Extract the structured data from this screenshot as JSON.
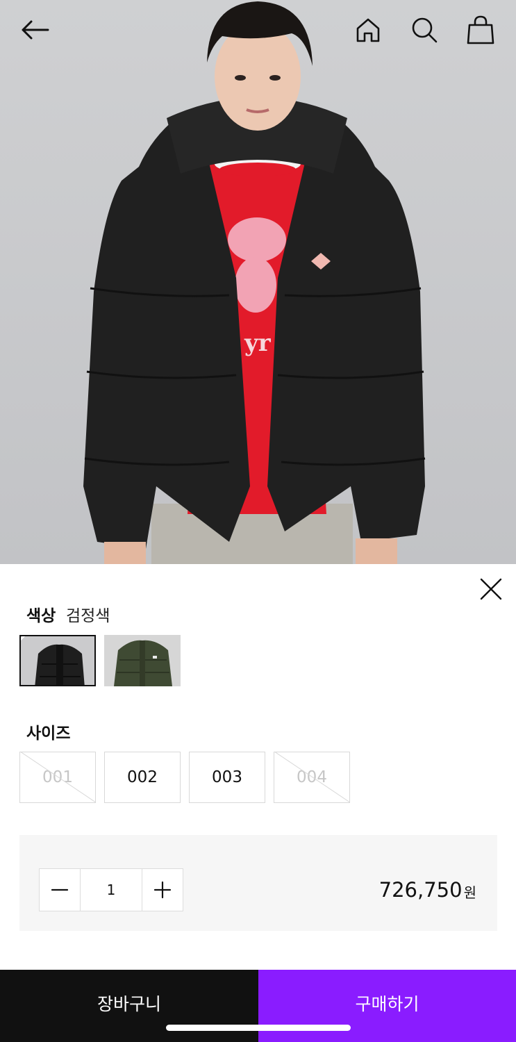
{
  "header": {
    "back_icon": "arrow-left-icon",
    "home_icon": "home-icon",
    "search_icon": "search-icon",
    "cart_icon": "shopping-bag-icon"
  },
  "product_image": {
    "badge_text": "",
    "colors": {
      "background": "#c8c9cb",
      "jacket": "#202020",
      "sweater": "#e21b2a"
    }
  },
  "options": {
    "close_icon": "close-icon",
    "color_label": "색상",
    "color_value": "검정색",
    "swatches": [
      {
        "name": "black",
        "selected": true,
        "color": "#1e1e1e"
      },
      {
        "name": "olive",
        "selected": false,
        "color": "#3f4a33"
      }
    ],
    "size_label": "사이즈",
    "sizes": [
      {
        "label": "001",
        "available": false
      },
      {
        "label": "002",
        "available": true
      },
      {
        "label": "003",
        "available": true
      },
      {
        "label": "004",
        "available": false
      }
    ]
  },
  "quantity": {
    "value": "1",
    "minus_icon": "minus-icon",
    "plus_icon": "plus-icon"
  },
  "price": {
    "amount": "726,750",
    "unit": "원"
  },
  "actions": {
    "cart_label": "장바구니",
    "buy_label": "구매하기",
    "buy_color": "#8a1cff"
  }
}
